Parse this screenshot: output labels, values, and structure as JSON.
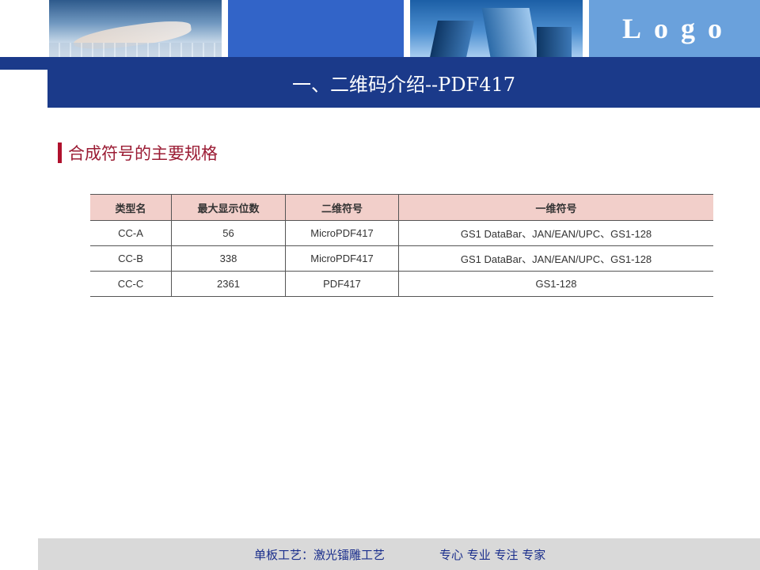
{
  "header": {
    "logo_text": "Logo"
  },
  "title": "一、二维码介绍--PDF417",
  "section_heading": "合成符号的主要规格",
  "table": {
    "columns": [
      "类型名",
      "最大显示位数",
      "二维符号",
      "一维符号"
    ],
    "rows": [
      [
        "CC-A",
        "56",
        "MicroPDF417",
        "GS1 DataBar、JAN/EAN/UPC、GS1-128"
      ],
      [
        "CC-B",
        "338",
        "MicroPDF417",
        "GS1 DataBar、JAN/EAN/UPC、GS1-128"
      ],
      [
        "CC-C",
        "2361",
        "PDF417",
        "GS1-128"
      ]
    ]
  },
  "footer": {
    "left_text": "单板工艺：激光镭雕工艺",
    "right_text": "专心 专业 专注 专家"
  },
  "colors": {
    "title_bar": "#1b3a8a",
    "accent_red": "#b0112d",
    "table_header": "#f2cfca",
    "footer_bg": "#d9d9d9"
  }
}
